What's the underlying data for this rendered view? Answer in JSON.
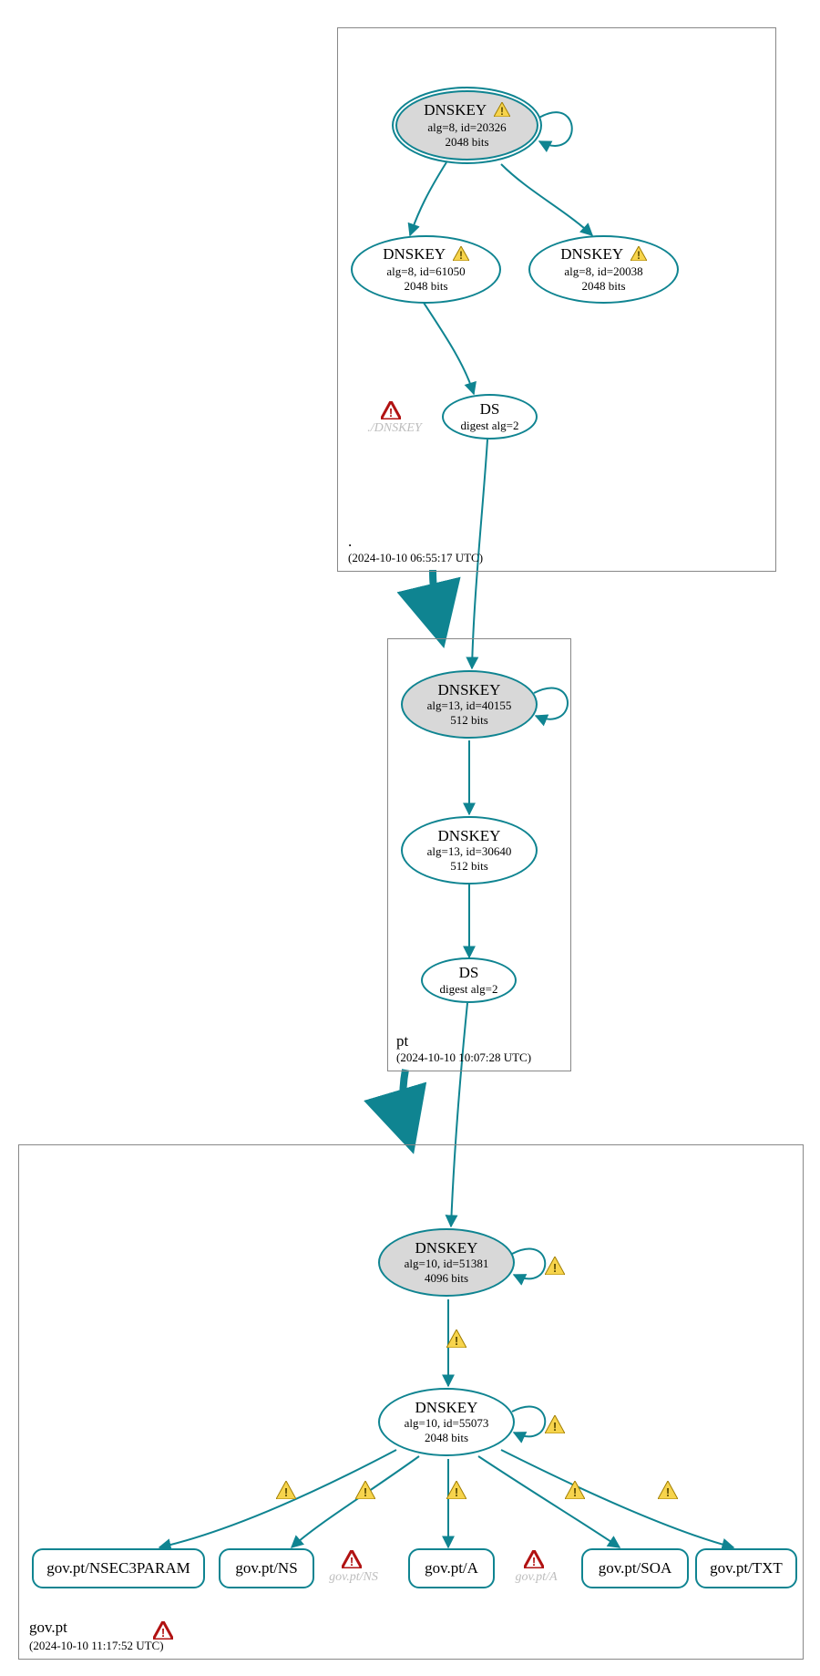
{
  "zones": {
    "root": {
      "label": ".",
      "timestamp": "(2024-10-10 06:55:17 UTC)"
    },
    "pt": {
      "label": "pt",
      "timestamp": "(2024-10-10 10:07:28 UTC)"
    },
    "govpt": {
      "label": "gov.pt",
      "timestamp": "(2024-10-10 11:17:52 UTC)"
    }
  },
  "nodes": {
    "root_ksk": {
      "title": "DNSKEY",
      "line2": "alg=8, id=20326",
      "line3": "2048 bits",
      "warn": true
    },
    "root_zsk1": {
      "title": "DNSKEY",
      "line2": "alg=8, id=61050",
      "line3": "2048 bits",
      "warn": true
    },
    "root_zsk2": {
      "title": "DNSKEY",
      "line2": "alg=8, id=20038",
      "line3": "2048 bits",
      "warn": true
    },
    "root_ds": {
      "title": "DS",
      "line2": "digest alg=2"
    },
    "pt_ksk": {
      "title": "DNSKEY",
      "line2": "alg=13, id=40155",
      "line3": "512 bits"
    },
    "pt_zsk": {
      "title": "DNSKEY",
      "line2": "alg=13, id=30640",
      "line3": "512 bits"
    },
    "pt_ds": {
      "title": "DS",
      "line2": "digest alg=2"
    },
    "gov_ksk": {
      "title": "DNSKEY",
      "line2": "alg=10, id=51381",
      "line3": "4096 bits"
    },
    "gov_zsk": {
      "title": "DNSKEY",
      "line2": "alg=10, id=55073",
      "line3": "2048 bits"
    }
  },
  "rrsets": {
    "nsec3": "gov.pt/NSEC3PARAM",
    "ns": "gov.pt/NS",
    "a": "gov.pt/A",
    "soa": "gov.pt/SOA",
    "txt": "gov.pt/TXT"
  },
  "ghosts": {
    "root_dnskey": "./DNSKEY",
    "gov_ns": "gov.pt/NS",
    "gov_a": "gov.pt/A"
  }
}
